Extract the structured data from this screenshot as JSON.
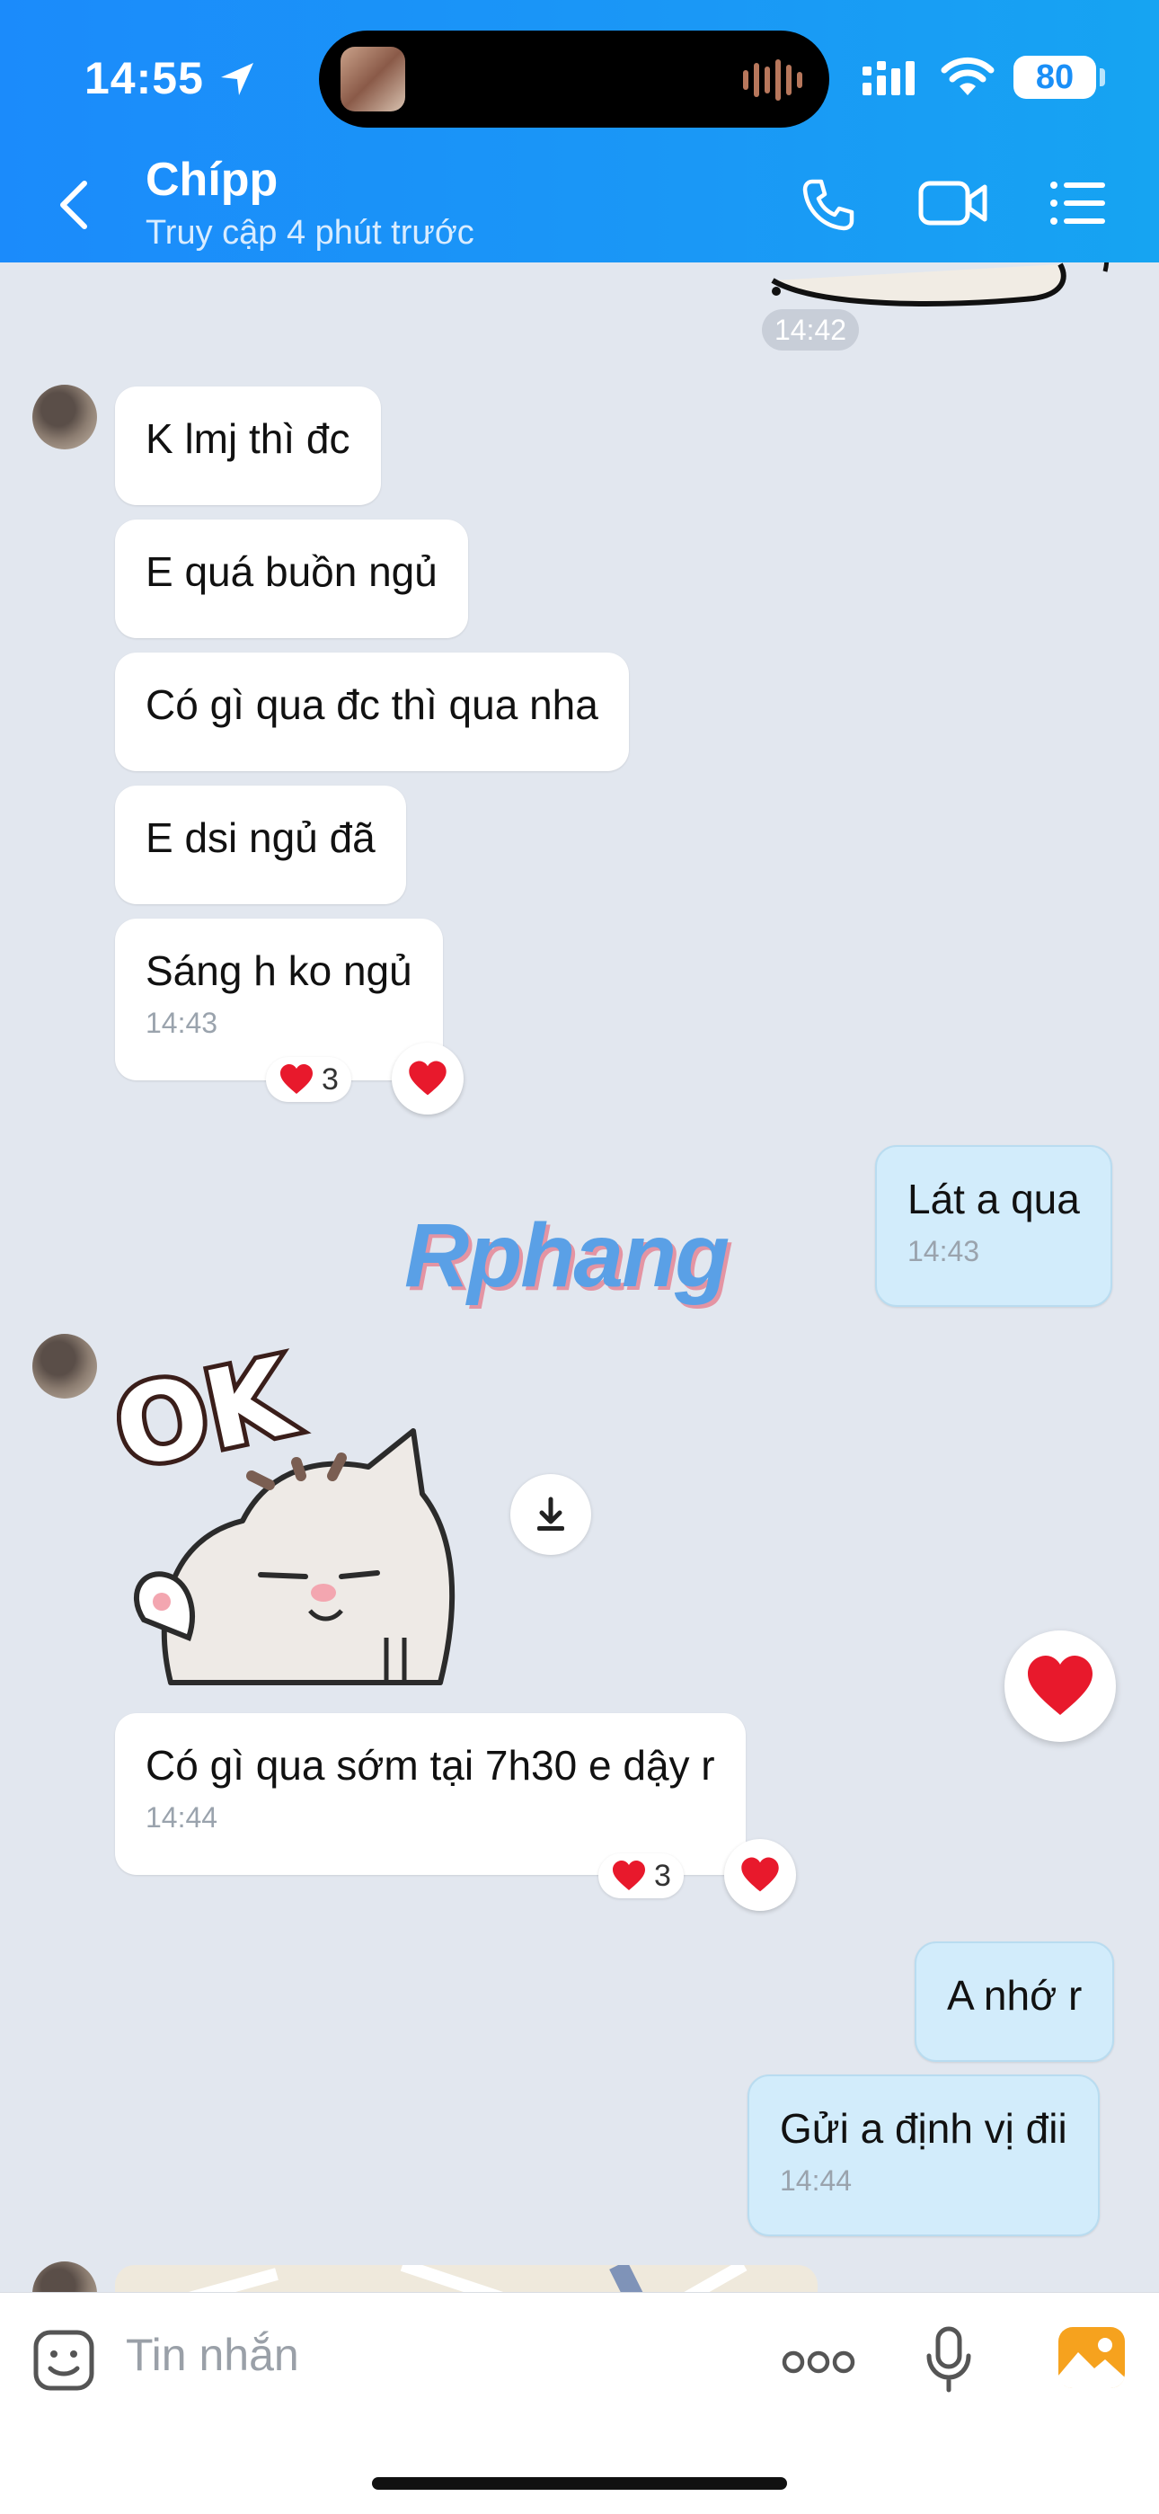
{
  "status_bar": {
    "time": "14:55",
    "battery": "80"
  },
  "header": {
    "contact_name": "Chípp",
    "contact_status": "Truy cập 4 phút trước"
  },
  "chat": {
    "top_timestamp": "14:42",
    "incoming_1": [
      "K lmj thì đc",
      "E quá buồn ngủ",
      "Có gì qua đc thì qua nha",
      "E dsi ngủ đã",
      "Sáng h ko ngủ"
    ],
    "incoming_1_time": "14:43",
    "incoming_1_reactions": "3",
    "outgoing_1": {
      "text": "Lát a qua",
      "time": "14:43"
    },
    "watermark": "Rphang",
    "sticker_text": "OK",
    "incoming_2": {
      "text": "Có gì qua sớm tại 7h30 e dậy r",
      "time": "14:44",
      "reactions": "3"
    },
    "outgoing_2": {
      "text": "A nhớ r"
    },
    "outgoing_3": {
      "text": "Gửi a định vị đii",
      "time": "14:44"
    }
  },
  "composer": {
    "placeholder": "Tin nhắn"
  },
  "colors": {
    "header_blue": "#1b8bfb",
    "heart_red": "#e8192c",
    "my_bubble": "#d2ecfb"
  }
}
